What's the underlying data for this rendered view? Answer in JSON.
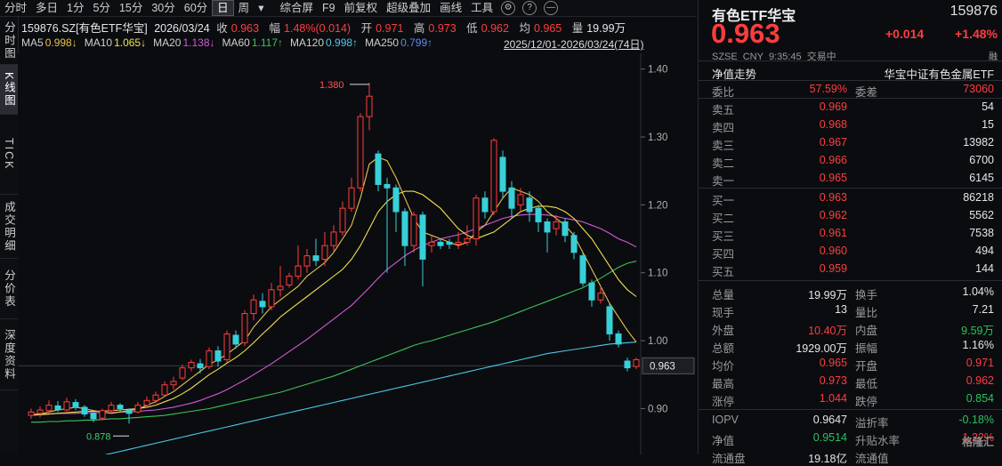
{
  "toolbar": {
    "items": [
      "分时",
      "多日",
      "1分",
      "5分",
      "15分",
      "30分",
      "60分",
      "日",
      "周"
    ],
    "active": "日",
    "right_items": [
      "综合屏",
      "F9",
      "前复权",
      "超级叠加",
      "画线",
      "工具"
    ]
  },
  "sidetabs": [
    "分时图",
    "K线图",
    "TICK",
    "成交明细",
    "分价表",
    "深度资料"
  ],
  "chart_header": {
    "symbol": "159876.SZ[有色ETF华宝]",
    "date": "2026/03/24",
    "close_label": "收",
    "close": "0.963",
    "amp_label": "幅",
    "amp": "1.48%(0.014)",
    "open_label": "开",
    "open": "0.971",
    "high_label": "高",
    "high": "0.973",
    "low_label": "低",
    "low": "0.962",
    "avg_label": "均",
    "avg": "0.965",
    "vol_label": "量",
    "vol": "19.99万"
  },
  "ma_line": [
    {
      "label": "MA5",
      "value": "0.998↓",
      "color": "#e8c24a"
    },
    {
      "label": "MA10",
      "value": "1.065↓",
      "color": "#f0e050"
    },
    {
      "label": "MA20",
      "value": "1.138↓",
      "color": "#d25ad6"
    },
    {
      "label": "MA60",
      "value": "1.117↑",
      "color": "#3cc35a"
    },
    {
      "label": "MA120",
      "value": "0.998↑",
      "color": "#4ec8e8"
    },
    {
      "label": "MA250",
      "value": "0.799↑",
      "color": "#5a8cf0"
    }
  ],
  "date_range": "2025/12/01-2026/03/24(74日)",
  "chart_data": {
    "type": "candlestick",
    "ylim": [
      0.86,
      1.41
    ],
    "yticks": [
      "1.40",
      "1.30",
      "1.20",
      "1.10",
      "1.00",
      "0.90"
    ],
    "yticks_values": [
      1.4,
      1.3,
      1.2,
      1.1,
      1.0,
      0.9
    ],
    "current_price": "0.963",
    "current_price_value": 0.963,
    "max_label": "1.380",
    "max_value": 1.38,
    "min_label": "0.878",
    "min_value": 0.878,
    "up_color": "#ff3d3d",
    "down_color": "#38d0d8",
    "candles": [
      [
        0.89,
        0.895,
        0.885,
        0.9
      ],
      [
        0.893,
        0.898,
        0.887,
        0.903
      ],
      [
        0.897,
        0.905,
        0.893,
        0.912
      ],
      [
        0.904,
        0.898,
        0.895,
        0.911
      ],
      [
        0.898,
        0.91,
        0.896,
        0.916
      ],
      [
        0.909,
        0.902,
        0.898,
        0.914
      ],
      [
        0.902,
        0.892,
        0.888,
        0.905
      ],
      [
        0.893,
        0.885,
        0.88,
        0.897
      ],
      [
        0.886,
        0.897,
        0.883,
        0.9
      ],
      [
        0.897,
        0.905,
        0.892,
        0.91
      ],
      [
        0.905,
        0.9,
        0.896,
        0.908
      ],
      [
        0.898,
        0.893,
        0.878,
        0.9
      ],
      [
        0.895,
        0.905,
        0.893,
        0.91
      ],
      [
        0.905,
        0.912,
        0.902,
        0.918
      ],
      [
        0.912,
        0.92,
        0.908,
        0.925
      ],
      [
        0.92,
        0.935,
        0.918,
        0.94
      ],
      [
        0.935,
        0.94,
        0.928,
        0.947
      ],
      [
        0.945,
        0.96,
        0.942,
        0.965
      ],
      [
        0.96,
        0.968,
        0.955,
        0.972
      ],
      [
        0.966,
        0.96,
        0.952,
        0.973
      ],
      [
        0.962,
        0.985,
        0.958,
        0.99
      ],
      [
        0.985,
        0.97,
        0.962,
        0.992
      ],
      [
        0.972,
        1.01,
        0.968,
        1.015
      ],
      [
        1.008,
        0.995,
        0.988,
        1.015
      ],
      [
        0.997,
        1.04,
        0.992,
        1.045
      ],
      [
        1.04,
        1.06,
        1.03,
        1.068
      ],
      [
        1.058,
        1.05,
        1.04,
        1.07
      ],
      [
        1.05,
        1.075,
        1.045,
        1.085
      ],
      [
        1.075,
        1.08,
        1.065,
        1.11
      ],
      [
        1.082,
        1.095,
        1.078,
        1.1
      ],
      [
        1.095,
        1.11,
        1.09,
        1.14
      ],
      [
        1.11,
        1.125,
        1.1,
        1.135
      ],
      [
        1.125,
        1.118,
        1.11,
        1.15
      ],
      [
        1.12,
        1.14,
        1.11,
        1.16
      ],
      [
        1.14,
        1.16,
        1.13,
        1.17
      ],
      [
        1.16,
        1.195,
        1.155,
        1.205
      ],
      [
        1.195,
        1.225,
        1.19,
        1.24
      ],
      [
        1.225,
        1.33,
        1.22,
        1.335
      ],
      [
        1.33,
        1.36,
        1.31,
        1.38
      ],
      [
        1.275,
        1.23,
        1.22,
        1.28
      ],
      [
        1.23,
        1.225,
        1.1,
        1.24
      ],
      [
        1.225,
        1.19,
        1.16,
        1.23
      ],
      [
        1.19,
        1.14,
        1.11,
        1.195
      ],
      [
        1.14,
        1.185,
        1.13,
        1.19
      ],
      [
        1.185,
        1.12,
        1.08,
        1.19
      ],
      [
        1.14,
        1.145,
        1.13,
        1.155
      ],
      [
        1.145,
        1.14,
        1.135,
        1.15
      ],
      [
        1.145,
        1.142,
        1.135,
        1.15
      ],
      [
        1.142,
        1.145,
        1.135,
        1.16
      ],
      [
        1.145,
        1.15,
        1.14,
        1.17
      ],
      [
        1.15,
        1.21,
        1.14,
        1.215
      ],
      [
        1.21,
        1.19,
        1.18,
        1.22
      ],
      [
        1.19,
        1.295,
        1.185,
        1.298
      ],
      [
        1.27,
        1.22,
        1.21,
        1.28
      ],
      [
        1.225,
        1.195,
        1.18,
        1.235
      ],
      [
        1.2,
        1.215,
        1.19,
        1.225
      ],
      [
        1.21,
        1.19,
        1.175,
        1.22
      ],
      [
        1.195,
        1.175,
        1.16,
        1.2
      ],
      [
        1.175,
        1.16,
        1.13,
        1.18
      ],
      [
        1.165,
        1.175,
        1.155,
        1.185
      ],
      [
        1.175,
        1.155,
        1.145,
        1.18
      ],
      [
        1.155,
        1.13,
        1.12,
        1.16
      ],
      [
        1.125,
        1.085,
        1.08,
        1.13
      ],
      [
        1.085,
        1.06,
        1.05,
        1.09
      ],
      [
        1.06,
        1.07,
        1.055,
        1.08
      ],
      [
        1.05,
        1.01,
        1.0,
        1.055
      ],
      [
        1.01,
        0.995,
        0.99,
        1.015
      ],
      [
        0.97,
        0.96,
        0.955,
        0.975
      ],
      [
        0.962,
        0.972,
        0.958,
        0.975
      ]
    ],
    "ma5": [
      0.89,
      0.892,
      0.895,
      0.898,
      0.9,
      0.902,
      0.9,
      0.897,
      0.895,
      0.893,
      0.895,
      0.897,
      0.899,
      0.905,
      0.91,
      0.918,
      0.925,
      0.935,
      0.945,
      0.955,
      0.965,
      0.972,
      0.98,
      0.99,
      1.0,
      1.02,
      1.035,
      1.05,
      1.06,
      1.07,
      1.08,
      1.095,
      1.105,
      1.115,
      1.13,
      1.15,
      1.17,
      1.21,
      1.26,
      1.27,
      1.265,
      1.24,
      1.21,
      1.18,
      1.16,
      1.155,
      1.15,
      1.145,
      1.14,
      1.145,
      1.16,
      1.17,
      1.19,
      1.21,
      1.225,
      1.22,
      1.215,
      1.205,
      1.19,
      1.18,
      1.17,
      1.155,
      1.13,
      1.105,
      1.08,
      1.055,
      1.035,
      1.015,
      0.998
    ],
    "ma10": [
      0.89,
      0.891,
      0.892,
      0.893,
      0.894,
      0.895,
      0.896,
      0.896,
      0.896,
      0.897,
      0.898,
      0.899,
      0.9,
      0.902,
      0.905,
      0.91,
      0.915,
      0.922,
      0.93,
      0.94,
      0.95,
      0.958,
      0.967,
      0.975,
      0.985,
      0.997,
      1.01,
      1.022,
      1.035,
      1.045,
      1.055,
      1.065,
      1.075,
      1.085,
      1.095,
      1.105,
      1.12,
      1.14,
      1.165,
      1.19,
      1.205,
      1.215,
      1.22,
      1.22,
      1.215,
      1.205,
      1.195,
      1.18,
      1.165,
      1.155,
      1.15,
      1.155,
      1.16,
      1.17,
      1.18,
      1.19,
      1.195,
      1.198,
      1.198,
      1.196,
      1.19,
      1.18,
      1.165,
      1.15,
      1.13,
      1.11,
      1.09,
      1.075,
      1.065
    ],
    "ma20": [
      0.892,
      0.892,
      0.892,
      0.893,
      0.893,
      0.893,
      0.894,
      0.894,
      0.894,
      0.894,
      0.895,
      0.895,
      0.896,
      0.897,
      0.898,
      0.9,
      0.902,
      0.905,
      0.908,
      0.912,
      0.917,
      0.922,
      0.928,
      0.935,
      0.942,
      0.95,
      0.958,
      0.966,
      0.975,
      0.984,
      0.993,
      1.002,
      1.012,
      1.022,
      1.032,
      1.042,
      1.052,
      1.065,
      1.078,
      1.092,
      1.105,
      1.115,
      1.125,
      1.133,
      1.14,
      1.145,
      1.15,
      1.153,
      1.156,
      1.16,
      1.165,
      1.17,
      1.175,
      1.18,
      1.183,
      1.185,
      1.186,
      1.186,
      1.185,
      1.183,
      1.18,
      1.178,
      1.175,
      1.17,
      1.165,
      1.158,
      1.15,
      1.145,
      1.138
    ],
    "ma60": [
      0.88,
      0.88,
      0.881,
      0.881,
      0.882,
      0.882,
      0.883,
      0.883,
      0.884,
      0.885,
      0.885,
      0.886,
      0.887,
      0.888,
      0.889,
      0.89,
      0.892,
      0.894,
      0.896,
      0.898,
      0.9,
      0.903,
      0.906,
      0.909,
      0.912,
      0.915,
      0.918,
      0.921,
      0.924,
      0.928,
      0.932,
      0.936,
      0.94,
      0.944,
      0.948,
      0.953,
      0.958,
      0.963,
      0.968,
      0.973,
      0.978,
      0.983,
      0.988,
      0.993,
      0.997,
      1.0,
      1.004,
      1.008,
      1.012,
      1.016,
      1.02,
      1.024,
      1.028,
      1.033,
      1.038,
      1.043,
      1.048,
      1.053,
      1.058,
      1.063,
      1.068,
      1.073,
      1.078,
      1.085,
      1.092,
      1.1,
      1.108,
      1.114,
      1.117
    ],
    "ma120": [
      0.81,
      0.812,
      0.815,
      0.818,
      0.82,
      0.823,
      0.826,
      0.828,
      0.831,
      0.834,
      0.837,
      0.84,
      0.843,
      0.846,
      0.849,
      0.852,
      0.855,
      0.858,
      0.861,
      0.864,
      0.867,
      0.87,
      0.873,
      0.876,
      0.879,
      0.882,
      0.885,
      0.888,
      0.891,
      0.894,
      0.897,
      0.9,
      0.903,
      0.906,
      0.909,
      0.912,
      0.915,
      0.918,
      0.921,
      0.924,
      0.927,
      0.93,
      0.933,
      0.936,
      0.939,
      0.942,
      0.945,
      0.948,
      0.951,
      0.954,
      0.957,
      0.96,
      0.963,
      0.966,
      0.969,
      0.972,
      0.975,
      0.978,
      0.981,
      0.983,
      0.985,
      0.987,
      0.989,
      0.991,
      0.993,
      0.995,
      0.996,
      0.997,
      0.998
    ]
  },
  "panel": {
    "name": "有色ETF华宝",
    "code": "159876",
    "price": "0.963",
    "change": "+0.014",
    "pct": "+1.48%",
    "meta": [
      "SZSE",
      "CNY",
      "9:35:45",
      "交易中"
    ],
    "fav": "融",
    "nav_title": "净值走势",
    "nav_index": "华宝中证有色金属ETF",
    "wei_bi_label": "委比",
    "wei_bi": "57.59%",
    "wei_cha_label": "委差",
    "wei_cha": "73060",
    "asks": [
      {
        "label": "卖五",
        "price": "0.969",
        "vol": "54"
      },
      {
        "label": "卖四",
        "price": "0.968",
        "vol": "15"
      },
      {
        "label": "卖三",
        "price": "0.967",
        "vol": "13982"
      },
      {
        "label": "卖二",
        "price": "0.966",
        "vol": "6700"
      },
      {
        "label": "卖一",
        "price": "0.965",
        "vol": "6145"
      }
    ],
    "bids": [
      {
        "label": "买一",
        "price": "0.963",
        "vol": "86218"
      },
      {
        "label": "买二",
        "price": "0.962",
        "vol": "5562"
      },
      {
        "label": "买三",
        "price": "0.961",
        "vol": "7538"
      },
      {
        "label": "买四",
        "price": "0.960",
        "vol": "494"
      },
      {
        "label": "买五",
        "price": "0.959",
        "vol": "144"
      }
    ],
    "stats": [
      {
        "l1": "总量",
        "v1": "19.99万",
        "c1": "white",
        "l2": "换手",
        "v2": "1.04%",
        "c2": "white"
      },
      {
        "l1": "现手",
        "v1": "13",
        "c1": "white",
        "l2": "量比",
        "v2": "7.21",
        "c2": "white"
      },
      {
        "l1": "外盘",
        "v1": "10.40万",
        "c1": "up",
        "l2": "内盘",
        "v2": "9.59万",
        "c2": "down"
      },
      {
        "l1": "总额",
        "v1": "1929.00万",
        "c1": "white",
        "l2": "振幅",
        "v2": "1.16%",
        "c2": "white"
      },
      {
        "l1": "均价",
        "v1": "0.965",
        "c1": "up",
        "l2": "开盘",
        "v2": "0.971",
        "c2": "up"
      },
      {
        "l1": "最高",
        "v1": "0.973",
        "c1": "up",
        "l2": "最低",
        "v2": "0.962",
        "c2": "up"
      },
      {
        "l1": "涨停",
        "v1": "1.044",
        "c1": "up",
        "l2": "跌停",
        "v2": "0.854",
        "c2": "down"
      }
    ],
    "stats2": [
      {
        "l1": "IOPV",
        "v1": "0.9647",
        "c1": "white",
        "l2": "溢折率",
        "v2": "-0.18%",
        "c2": "down"
      },
      {
        "l1": "净值",
        "v1": "0.9514",
        "c1": "down",
        "l2": "升贴水率",
        "v2": "1.22%",
        "c2": "up"
      },
      {
        "l1": "流通盘",
        "v1": "19.18亿",
        "c1": "white",
        "l2": "流通值",
        "v2": "",
        "c2": "white"
      }
    ],
    "watermark": "格隆汇"
  }
}
